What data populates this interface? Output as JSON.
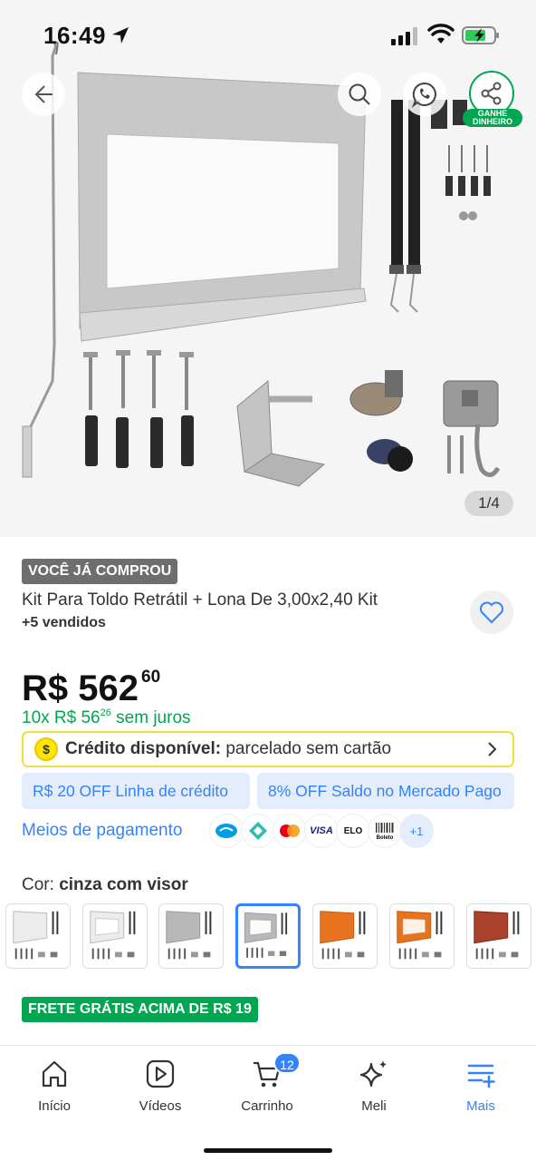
{
  "status_bar": {
    "time": "16:49"
  },
  "gallery": {
    "counter": "1/4",
    "share_badge": "GANHE DINHEIRO"
  },
  "product": {
    "bought_badge": "VOCÊ JÁ COMPROU",
    "title": "Kit Para Toldo Retrátil + Lona De  3,00x2,40 Kit",
    "sold": "+5 vendidos",
    "price_currency": "R$",
    "price_integer": "562",
    "price_cents": "60",
    "installments_prefix": "10x R$ 56",
    "installments_cents": "26",
    "installments_suffix": "sem juros"
  },
  "credit": {
    "bold": "Crédito disponível:",
    "text": "parcelado sem cartão"
  },
  "promos": {
    "credit_line": "R$ 20 OFF Linha de crédito",
    "mercado_pago": "8% OFF Saldo no Mercado Pago"
  },
  "payment": {
    "label": "Meios de pagamento",
    "methods": [
      "mercado-pago",
      "pix",
      "mastercard",
      "VISA",
      "ELO",
      "Boleto"
    ],
    "more": "+1"
  },
  "color": {
    "label": "Cor:",
    "selected": "cinza com visor",
    "swatches": [
      "branco",
      "branco com visor",
      "cinza",
      "cinza com visor",
      "laranja",
      "laranja com visor",
      "terracota"
    ]
  },
  "shipping_badge": "FRETE GRÁTIS ACIMA DE R$ 19",
  "bottom_nav": {
    "items": [
      "Início",
      "Vídeos",
      "Carrinho",
      "Meli",
      "Mais"
    ],
    "cart_count": "12",
    "active": "Mais"
  },
  "colors": {
    "accent_blue": "#3483fa",
    "green": "#00a650",
    "yellow": "#ffe600"
  }
}
